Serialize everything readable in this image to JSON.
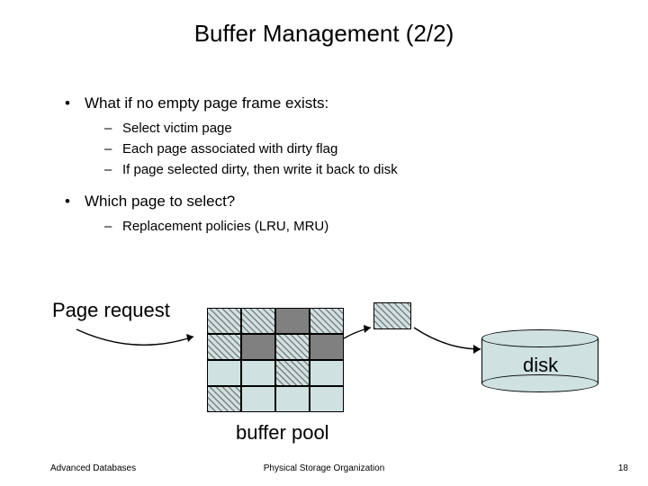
{
  "title": "Buffer Management (2/2)",
  "bullets": {
    "b1": "What if no empty page frame exists:",
    "b1_1": "Select victim page",
    "b1_2": "Each page associated with dirty flag",
    "b1_3": "If page selected dirty, then write it back to disk",
    "b2": "Which page to select?",
    "b2_1": "Replacement policies (LRU, MRU)"
  },
  "labels": {
    "page_request": "Page request",
    "buffer_pool": "buffer pool",
    "disk": "disk"
  },
  "footer": {
    "left": "Advanced Databases",
    "center": "Physical Storage Organization",
    "right": "18"
  },
  "colors": {
    "pool_bg": "#cfe1e1",
    "gray": "#808080"
  }
}
